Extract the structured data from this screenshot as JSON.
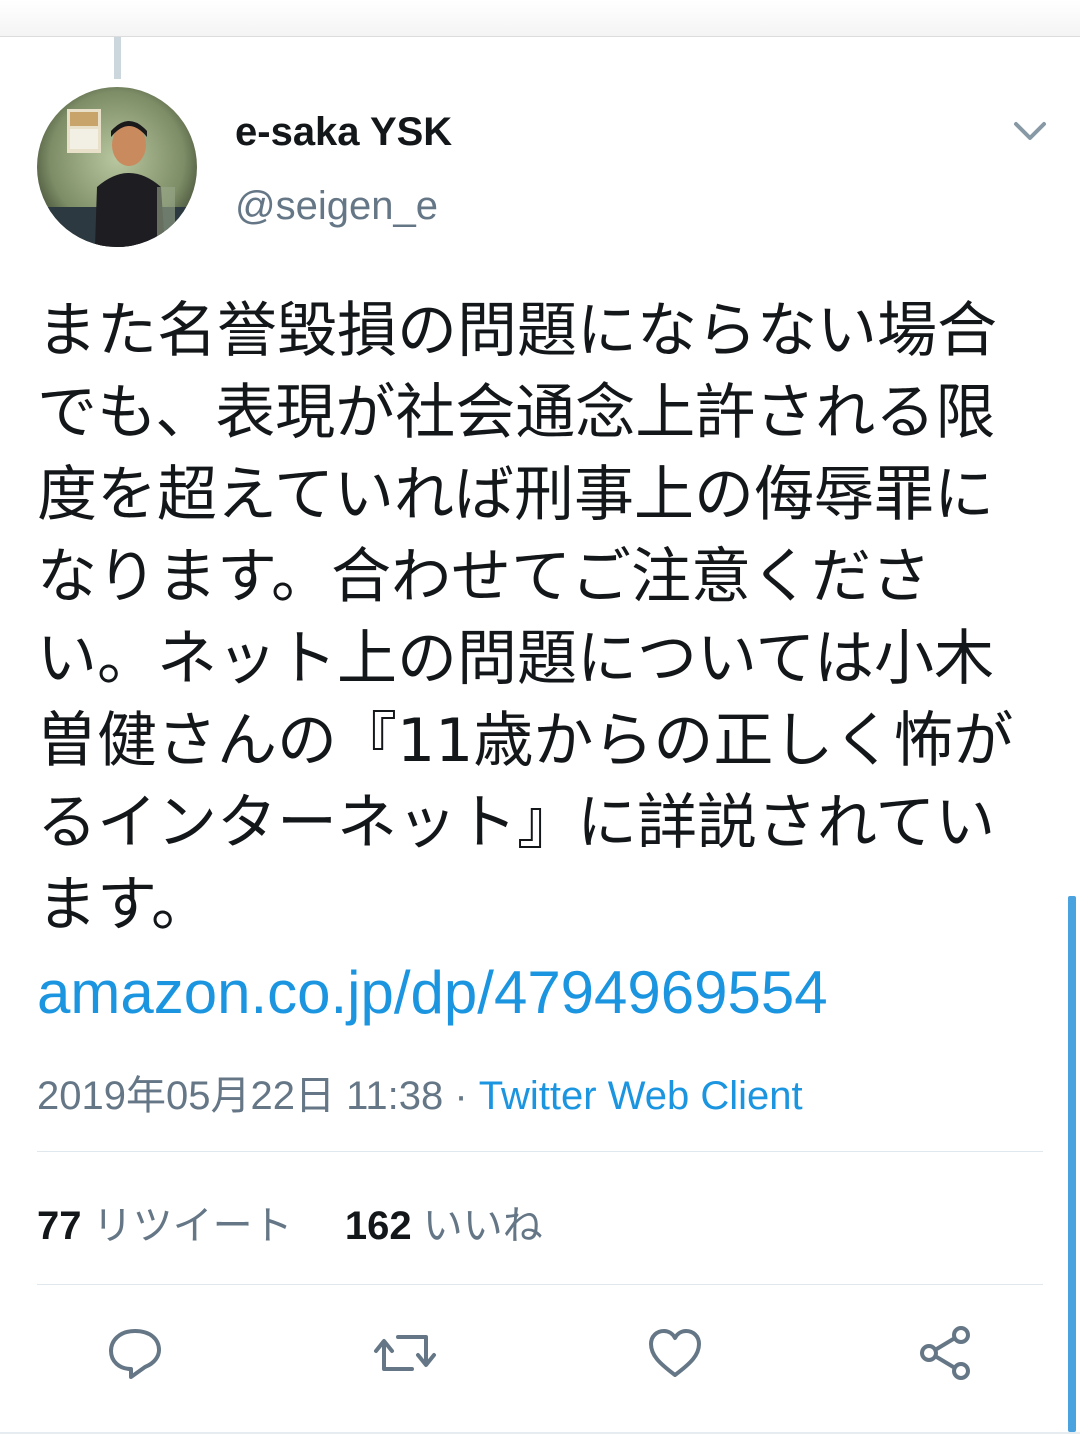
{
  "user": {
    "display_name": "e-saka YSK",
    "handle": "@seigen_e"
  },
  "tweet": {
    "text": "また名誉毀損の問題にならない場合でも、表現が社会通念上許される限度を超えていれば刑事上の侮辱罪になります。合わせてご注意ください。ネット上の問題については小木曽健さんの『11歳からの正しく怖がるインターネット』に詳説されています。",
    "link": "amazon.co.jp/dp/4794969554",
    "timestamp": "2019年05月22日 11:38",
    "separator": "·",
    "client": "Twitter Web Client"
  },
  "stats": {
    "retweet_count": "77",
    "retweet_label": "リツイート",
    "like_count": "162",
    "like_label": "いいね"
  },
  "colors": {
    "link": "#1b95e0",
    "secondary_text": "#657786",
    "icon": "#657786",
    "divider": "#e1e8ed"
  },
  "icons": [
    "chevron-down-icon",
    "reply-icon",
    "retweet-icon",
    "like-icon",
    "share-icon"
  ]
}
